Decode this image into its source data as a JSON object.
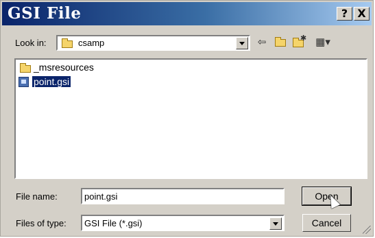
{
  "window": {
    "title": "GSI File",
    "help_label": "?",
    "close_label": "X"
  },
  "look_in": {
    "label": "Look in:",
    "value": "csamp"
  },
  "toolbar": {
    "back_icon": "back-arrow-icon",
    "up_icon": "up-folder-icon",
    "new_folder_icon": "new-folder-icon",
    "view_menu_icon": "view-menu-icon"
  },
  "files": [
    {
      "name": "_msresources",
      "type": "folder",
      "selected": false
    },
    {
      "name": "point.gsi",
      "type": "file",
      "selected": true
    }
  ],
  "file_name": {
    "label": "File name:",
    "value": "point.gsi"
  },
  "file_type": {
    "label": "Files of type:",
    "value": "GSI File (*.gsi)"
  },
  "buttons": {
    "open": "Open",
    "cancel": "Cancel"
  },
  "colors": {
    "title_start": "#0a246a",
    "title_end": "#a6caf0",
    "face": "#d4d0c8",
    "selection": "#0a246a"
  }
}
